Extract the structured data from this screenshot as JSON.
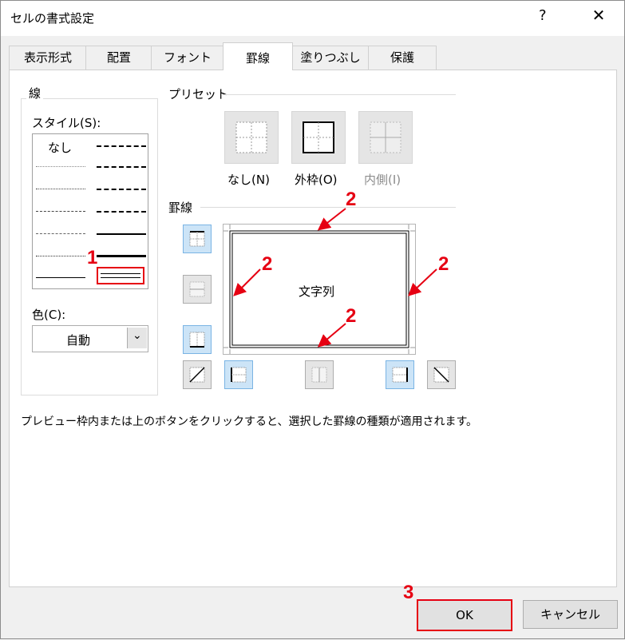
{
  "dialog": {
    "title": "セルの書式設定",
    "help_glyph": "?",
    "close_glyph": "✕"
  },
  "tabs": [
    {
      "label": "表示形式"
    },
    {
      "label": "配置"
    },
    {
      "label": "フォント"
    },
    {
      "label": "罫線",
      "active": true
    },
    {
      "label": "塗りつぶし"
    },
    {
      "label": "保護"
    }
  ],
  "line_group": {
    "legend": "線",
    "style_label": "スタイル(S):",
    "style_none": "なし",
    "color_label": "色(C):",
    "color_value": "自動"
  },
  "preset_group": {
    "legend": "プリセット",
    "none_label": "なし(N)",
    "outline_label": "外枠(O)",
    "inside_label": "内側(I)"
  },
  "border_group": {
    "legend": "罫線",
    "preview_text": "文字列"
  },
  "hint": "プレビュー枠内または上のボタンをクリックすると、選択した罫線の種類が適用されます。",
  "buttons": {
    "ok": "OK",
    "cancel": "キャンセル"
  },
  "annotations": {
    "step1": "1",
    "step2": "2",
    "step3": "3"
  },
  "colors": {
    "annotation_red": "#e60012",
    "toggle_on": "#cce4f7"
  }
}
